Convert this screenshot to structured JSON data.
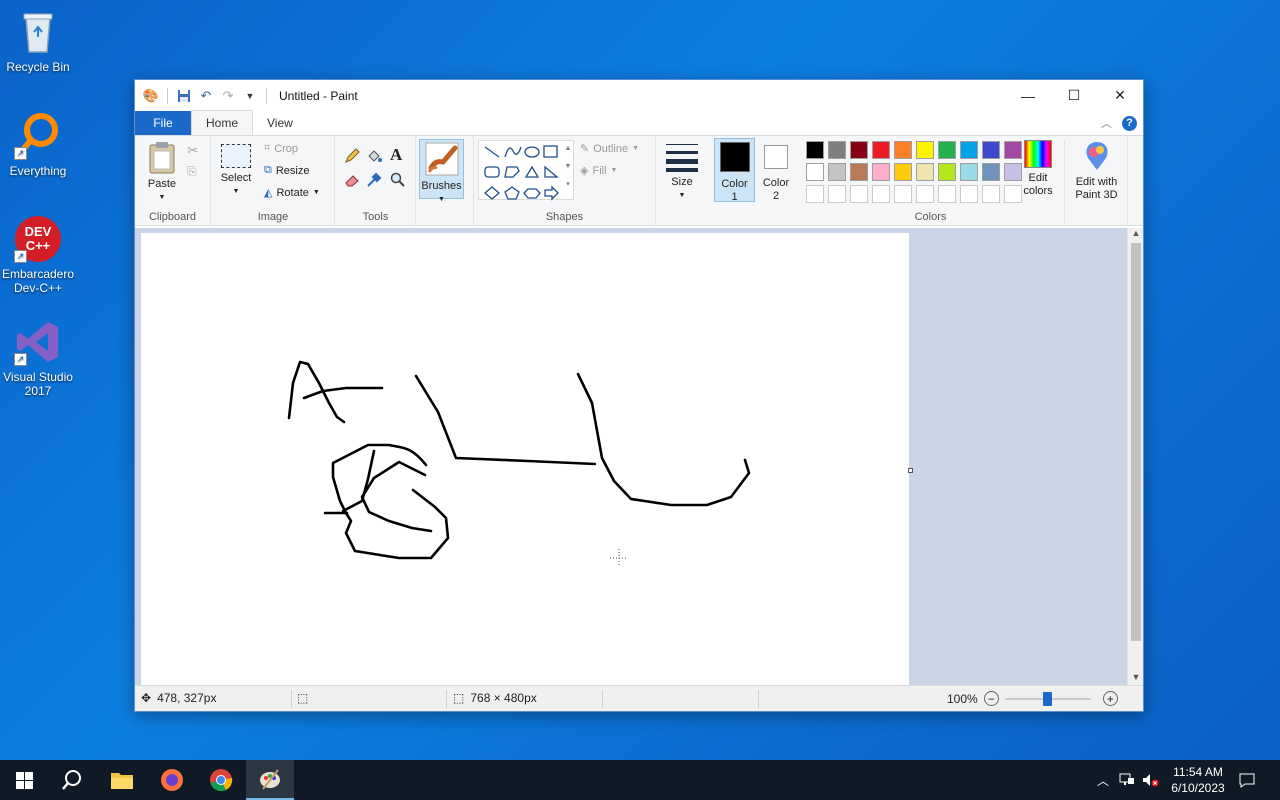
{
  "desktop": {
    "icons": [
      {
        "label": "Recycle Bin"
      },
      {
        "label": "Everything"
      },
      {
        "label": "Embarcadero Dev-C++"
      },
      {
        "label": "Visual Studio 2017"
      }
    ],
    "devcpp_logo_text": "DEV C++"
  },
  "window": {
    "title": "Untitled - Paint",
    "tabs": {
      "file": "File",
      "home": "Home",
      "view": "View"
    }
  },
  "ribbon": {
    "clipboard": {
      "label": "Clipboard",
      "paste": "Paste"
    },
    "image": {
      "label": "Image",
      "select": "Select",
      "crop": "Crop",
      "resize": "Resize",
      "rotate": "Rotate"
    },
    "tools": {
      "label": "Tools",
      "text_glyph": "A"
    },
    "brushes": {
      "label": "Brushes"
    },
    "shapes": {
      "label": "Shapes",
      "outline": "Outline",
      "fill": "Fill"
    },
    "size": {
      "label": "Size"
    },
    "color1": {
      "label": "Color 1",
      "value": "#000000"
    },
    "color2": {
      "label": "Color 2",
      "value": "#ffffff"
    },
    "colors": {
      "label": "Colors",
      "row1": [
        "#000000",
        "#7f7f7f",
        "#880015",
        "#ed1c24",
        "#ff7f27",
        "#fff200",
        "#22b14c",
        "#00a2e8",
        "#3f48cc",
        "#a349a4"
      ],
      "row2": [
        "#ffffff",
        "#c3c3c3",
        "#b97a57",
        "#ffaec9",
        "#ffc90e",
        "#efe4b0",
        "#b5e61d",
        "#99d9ea",
        "#7092be",
        "#c8bfe7"
      ],
      "row3_count": 10
    },
    "edit_colors": "Edit colors",
    "edit_paint3d": "Edit with Paint 3D"
  },
  "status": {
    "cursor_pos": "478, 327px",
    "image_size": "768 × 480px",
    "zoom": "100%"
  },
  "taskbar": {
    "time": "11:54 AM",
    "date": "6/10/2023"
  }
}
